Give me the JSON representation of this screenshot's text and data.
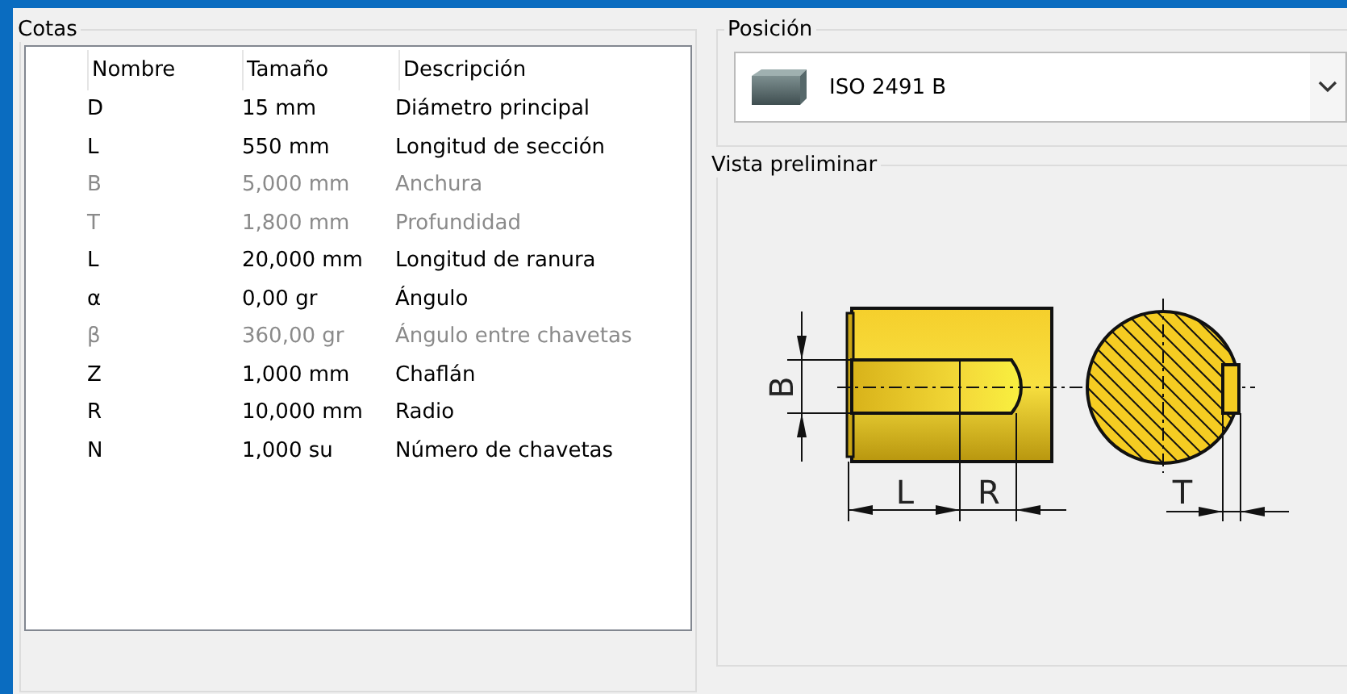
{
  "cotas": {
    "title": "Cotas",
    "columns": [
      "Nombre",
      "Tamaño",
      "Descripción"
    ],
    "rows": [
      {
        "name": "D",
        "size": "15 mm",
        "description": "Diámetro principal",
        "disabled": false
      },
      {
        "name": "L",
        "size": "550 mm",
        "description": "Longitud de sección",
        "disabled": false
      },
      {
        "name": "B",
        "size": "5,000 mm",
        "description": "Anchura",
        "disabled": true
      },
      {
        "name": "T",
        "size": "1,800 mm",
        "description": "Profundidad",
        "disabled": true
      },
      {
        "name": "L",
        "size": "20,000 mm",
        "description": "Longitud de ranura",
        "disabled": false
      },
      {
        "name": "α",
        "size": "0,00 gr",
        "description": "Ángulo",
        "disabled": false
      },
      {
        "name": "β",
        "size": "360,00 gr",
        "description": "Ángulo entre chavetas",
        "disabled": true
      },
      {
        "name": "Z",
        "size": "1,000 mm",
        "description": "Chaflán",
        "disabled": false
      },
      {
        "name": "R",
        "size": "10,000 mm",
        "description": "Radio",
        "disabled": false
      },
      {
        "name": "N",
        "size": "1,000 su",
        "description": "Número de chavetas",
        "disabled": false
      }
    ]
  },
  "posicion": {
    "title": "Posición",
    "value": "ISO 2491 B"
  },
  "preview": {
    "title": "Vista preliminar",
    "labels": [
      "B",
      "L",
      "R",
      "T"
    ]
  }
}
